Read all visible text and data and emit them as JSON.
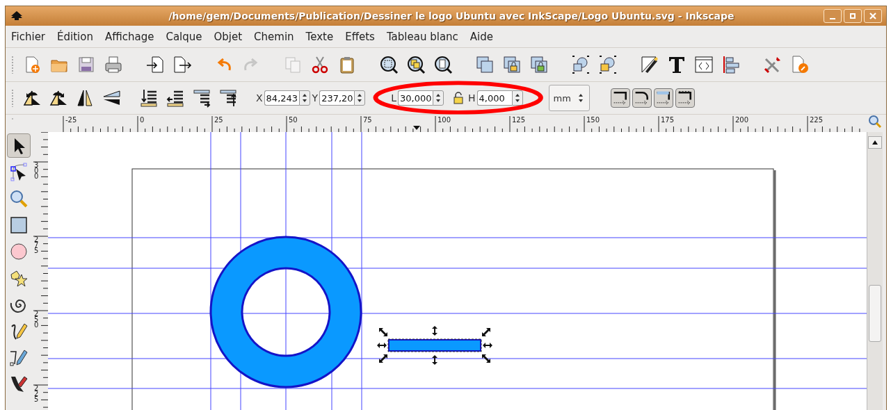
{
  "window": {
    "title": "/home/gem/Documents/Publication/Dessiner le logo Ubuntu avec InkScape/Logo Ubuntu.svg - Inkscape"
  },
  "menu": [
    "Fichier",
    "Édition",
    "Affichage",
    "Calque",
    "Objet",
    "Chemin",
    "Texte",
    "Effets",
    "Tableau blanc",
    "Aide"
  ],
  "main_toolbar": [
    {
      "buttons": [
        {
          "kind": "new",
          "disabled": false
        },
        {
          "kind": "open",
          "disabled": false
        },
        {
          "kind": "save",
          "disabled": false
        },
        {
          "kind": "print",
          "disabled": false
        }
      ]
    },
    {
      "buttons": [
        {
          "kind": "import",
          "disabled": false
        },
        {
          "kind": "export",
          "disabled": false
        }
      ]
    },
    {
      "buttons": [
        {
          "kind": "undo",
          "disabled": false
        },
        {
          "kind": "redo",
          "disabled": true
        }
      ]
    },
    {
      "buttons": [
        {
          "kind": "copy",
          "disabled": true
        },
        {
          "kind": "cut",
          "disabled": false
        },
        {
          "kind": "paste",
          "disabled": false
        }
      ]
    },
    {
      "buttons": [
        {
          "kind": "zoom-selection",
          "disabled": false
        },
        {
          "kind": "zoom-drawing",
          "disabled": false
        },
        {
          "kind": "zoom-page",
          "disabled": false
        }
      ]
    },
    {
      "buttons": [
        {
          "kind": "duplicate",
          "disabled": false
        },
        {
          "kind": "clone",
          "disabled": false
        },
        {
          "kind": "unlink",
          "disabled": false
        }
      ]
    },
    {
      "buttons": [
        {
          "kind": "group",
          "disabled": false
        },
        {
          "kind": "ungroup",
          "disabled": false
        }
      ]
    },
    {
      "buttons": [
        {
          "kind": "fill",
          "disabled": false
        },
        {
          "kind": "text",
          "disabled": false
        },
        {
          "kind": "xml",
          "disabled": false
        },
        {
          "kind": "align",
          "disabled": false
        }
      ]
    },
    {
      "buttons": [
        {
          "kind": "preferences",
          "disabled": false
        },
        {
          "kind": "document",
          "disabled": false
        }
      ]
    }
  ],
  "transform_toolbar": {
    "fields": [
      {
        "label": "X",
        "value": "84,243"
      },
      {
        "label": "Y",
        "value": "237,20"
      },
      {
        "label": "L",
        "value": "30,000"
      },
      {
        "label": "H",
        "value": "4,000"
      }
    ],
    "unit": "mm"
  },
  "ruler_h": [
    "-25",
    "0",
    "25",
    "50",
    "75",
    "100",
    "125",
    "150",
    "175",
    "200",
    "225"
  ],
  "ruler_v": [
    "300",
    "275",
    "250",
    "225"
  ],
  "tools": [
    {
      "kind": "selector",
      "selected": true
    },
    {
      "kind": "node",
      "selected": false
    },
    {
      "kind": "zoom",
      "selected": false
    },
    {
      "kind": "rect",
      "selected": false
    },
    {
      "kind": "ellipse",
      "selected": false
    },
    {
      "kind": "star",
      "selected": false
    },
    {
      "kind": "spiral",
      "selected": false
    },
    {
      "kind": "pencil",
      "selected": false
    },
    {
      "kind": "pen",
      "selected": false
    },
    {
      "kind": "calligraphy",
      "selected": false
    }
  ]
}
